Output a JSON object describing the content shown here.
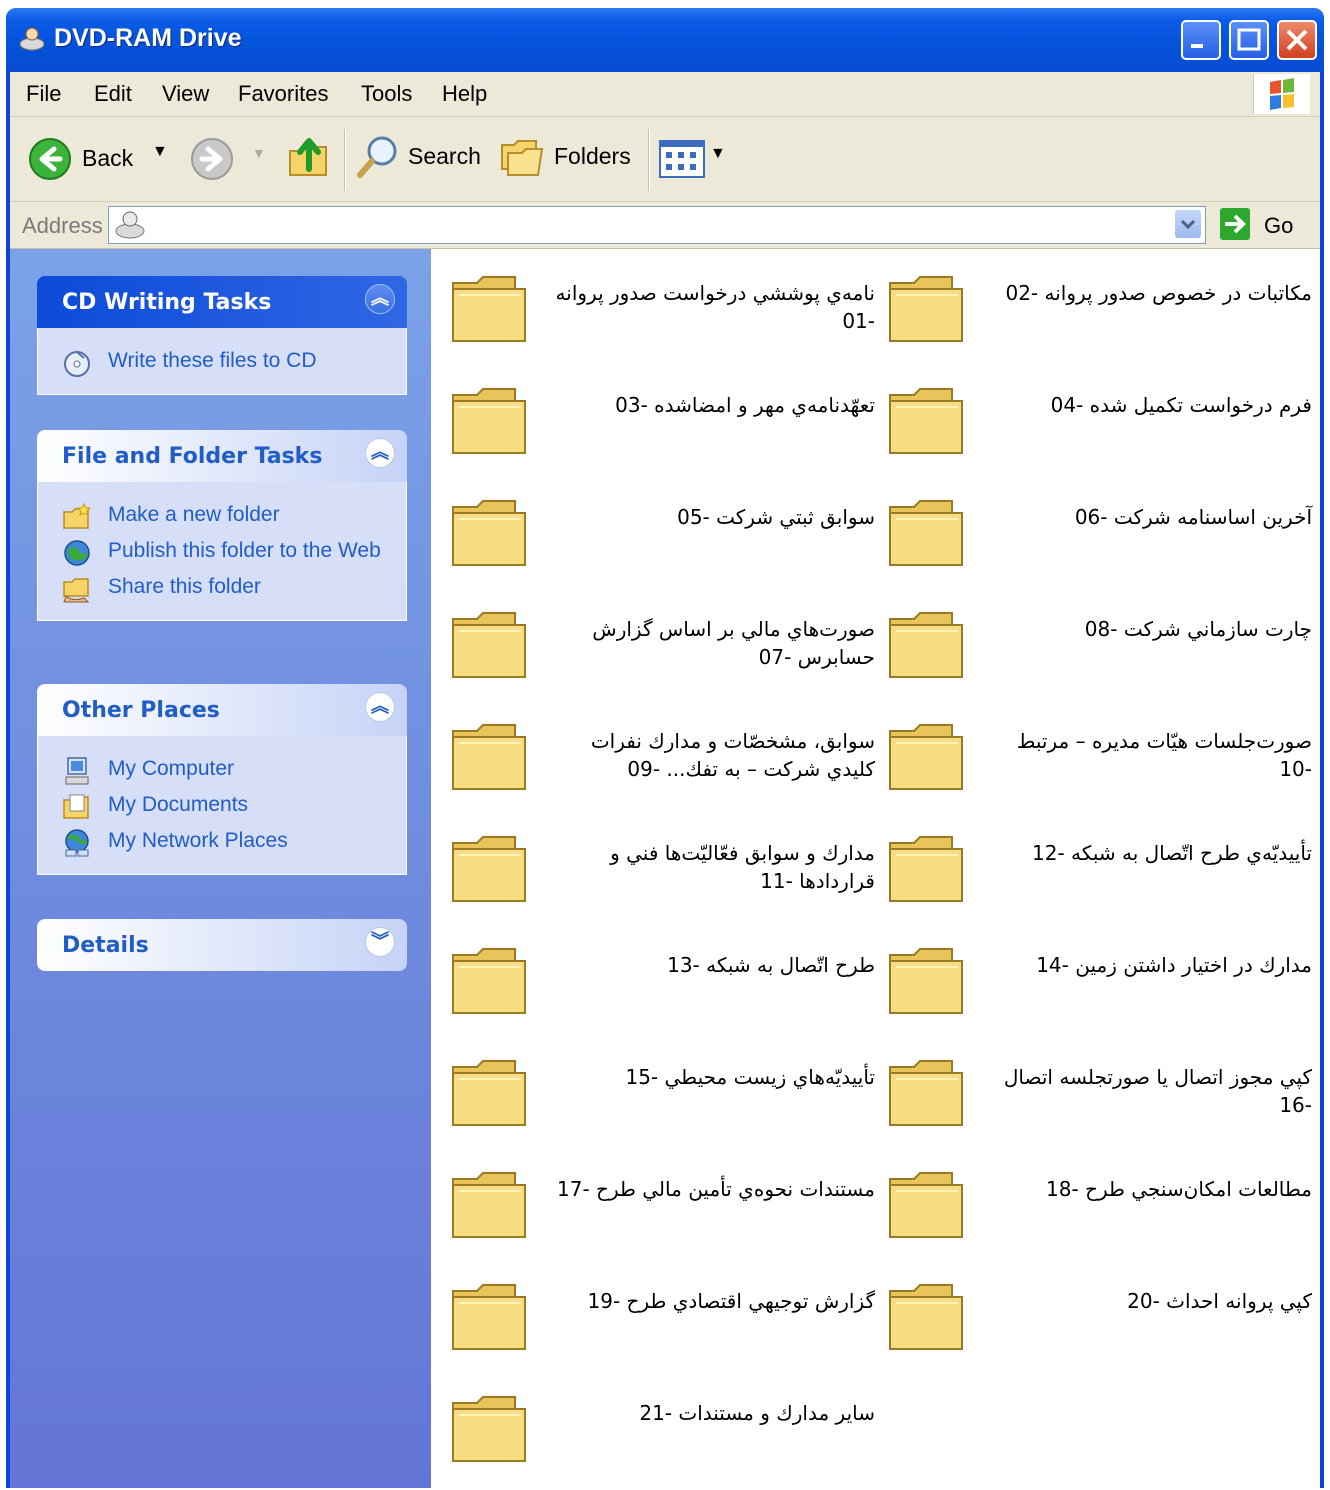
{
  "window": {
    "title": "DVD-RAM Drive",
    "icons": {
      "app": "dvd-drive-icon",
      "minimize": "minimize-icon",
      "maximize": "maximize-icon",
      "close": "close-icon"
    }
  },
  "menubar": {
    "items": [
      "File",
      "Edit",
      "View",
      "Favorites",
      "Tools",
      "Help"
    ]
  },
  "toolbar": {
    "back_label": "Back",
    "search_label": "Search",
    "folders_label": "Folders"
  },
  "address": {
    "label": "Address",
    "value": "",
    "go_label": "Go"
  },
  "sidebar": {
    "cd_tasks": {
      "title": "CD Writing Tasks",
      "items": [
        "Write these files to CD"
      ]
    },
    "file_tasks": {
      "title": "File and Folder Tasks",
      "items": [
        "Make a new folder",
        "Publish this folder to the Web",
        "Share this folder"
      ]
    },
    "other_places": {
      "title": "Other Places",
      "items": [
        "My Computer",
        "My Documents",
        "My Network Places"
      ]
    },
    "details": {
      "title": "Details"
    }
  },
  "folders": [
    "نامه‌ي پوششي درخواست صدور پروانه -01",
    "مكاتبات در خصوص صدور پروانه -02",
    "تعهّدنامه‌ي مهر و امضاشده -03",
    "فرم درخواست تكميل شده -04",
    "سوابق ثبتي شركت -05",
    "آخرين اساسنامه شركت -06",
    "صورت‌هاي مالي بر اساس گزارش حسابرس -07",
    "چارت سازماني شركت -08",
    "سوابق، مشخصّات و مدارك نفرات كليدي شركت – به تفك... -09",
    "صورت‌جلسات هيّات مديره – مرتبط -10",
    "مدارك و سوابق فعّاليّت‌ها فني و قراردادها -11",
    "تأييديّه‌ي طرح اتّصال به شبكه -12",
    "طرح اتّصال به شبكه -13",
    "مدارك در اختيار داشتن زمين -14",
    "تأييديّه‌هاي زيست محيطي -15",
    "كپي مجوز اتصال يا صورتجلسه اتصال -16",
    "مستندات نحوه‌ي تأمين مالي طرح -17",
    "مطالعات امكان‌سنجي طرح -18",
    "گزارش توجيهي اقتصادي طرح -19",
    "كپي پروانه احداث -20",
    "ساير مدارك و مستندات -21"
  ],
  "colors": {
    "titlebar": "#0552da",
    "sidebar": "#6f8fe0",
    "link": "#215dc6",
    "folder": "#f7d876"
  }
}
